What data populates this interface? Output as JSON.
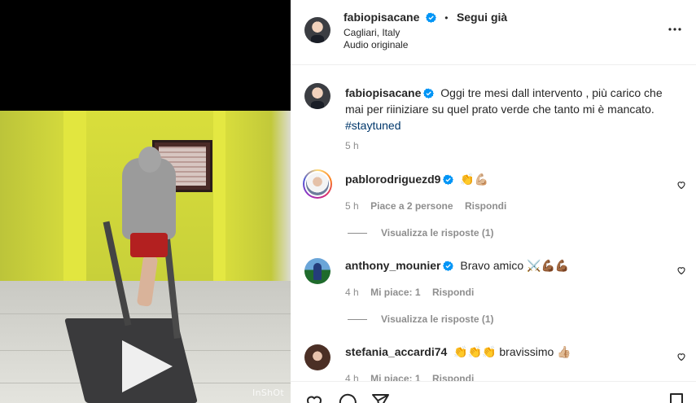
{
  "post": {
    "username": "fabiopisacane",
    "follow_label": "Segui già",
    "separator": "•",
    "location": "Cagliari, Italy",
    "audio": "Audio originale",
    "more_icon": "more-horizontal-icon"
  },
  "media": {
    "watermark": "InShOt",
    "play_icon": "play-icon"
  },
  "caption": {
    "username": "fabiopisacane",
    "text_line1": "Oggi tre mesi dall intervento , più carico che",
    "text_line2": "mai per riiniziare su quel prato verde che tanto mi è mancato.",
    "hashtag": "#staytuned",
    "time": "5 h"
  },
  "comments": [
    {
      "username": "pablorodriguezd9",
      "text": "👏💪🏼",
      "time": "5 h",
      "likes": "Piace a 2 persone",
      "reply": "Rispondi",
      "view_replies": "Visualizza le risposte (1)"
    },
    {
      "username": "anthony_mounier",
      "text": "Bravo amico ⚔️💪🏾💪🏾",
      "time": "4 h",
      "likes": "Mi piace: 1",
      "reply": "Rispondi",
      "view_replies": "Visualizza le risposte (1)"
    },
    {
      "username": "stefania_accardi74",
      "text": "👏👏👏 bravissimo 👍🏼",
      "time": "4 h",
      "likes": "Mi piace: 1",
      "reply": "Rispondi"
    }
  ],
  "colors": {
    "verified": "#0095f6",
    "link": "#00376b",
    "meta": "#8e8e8e"
  }
}
